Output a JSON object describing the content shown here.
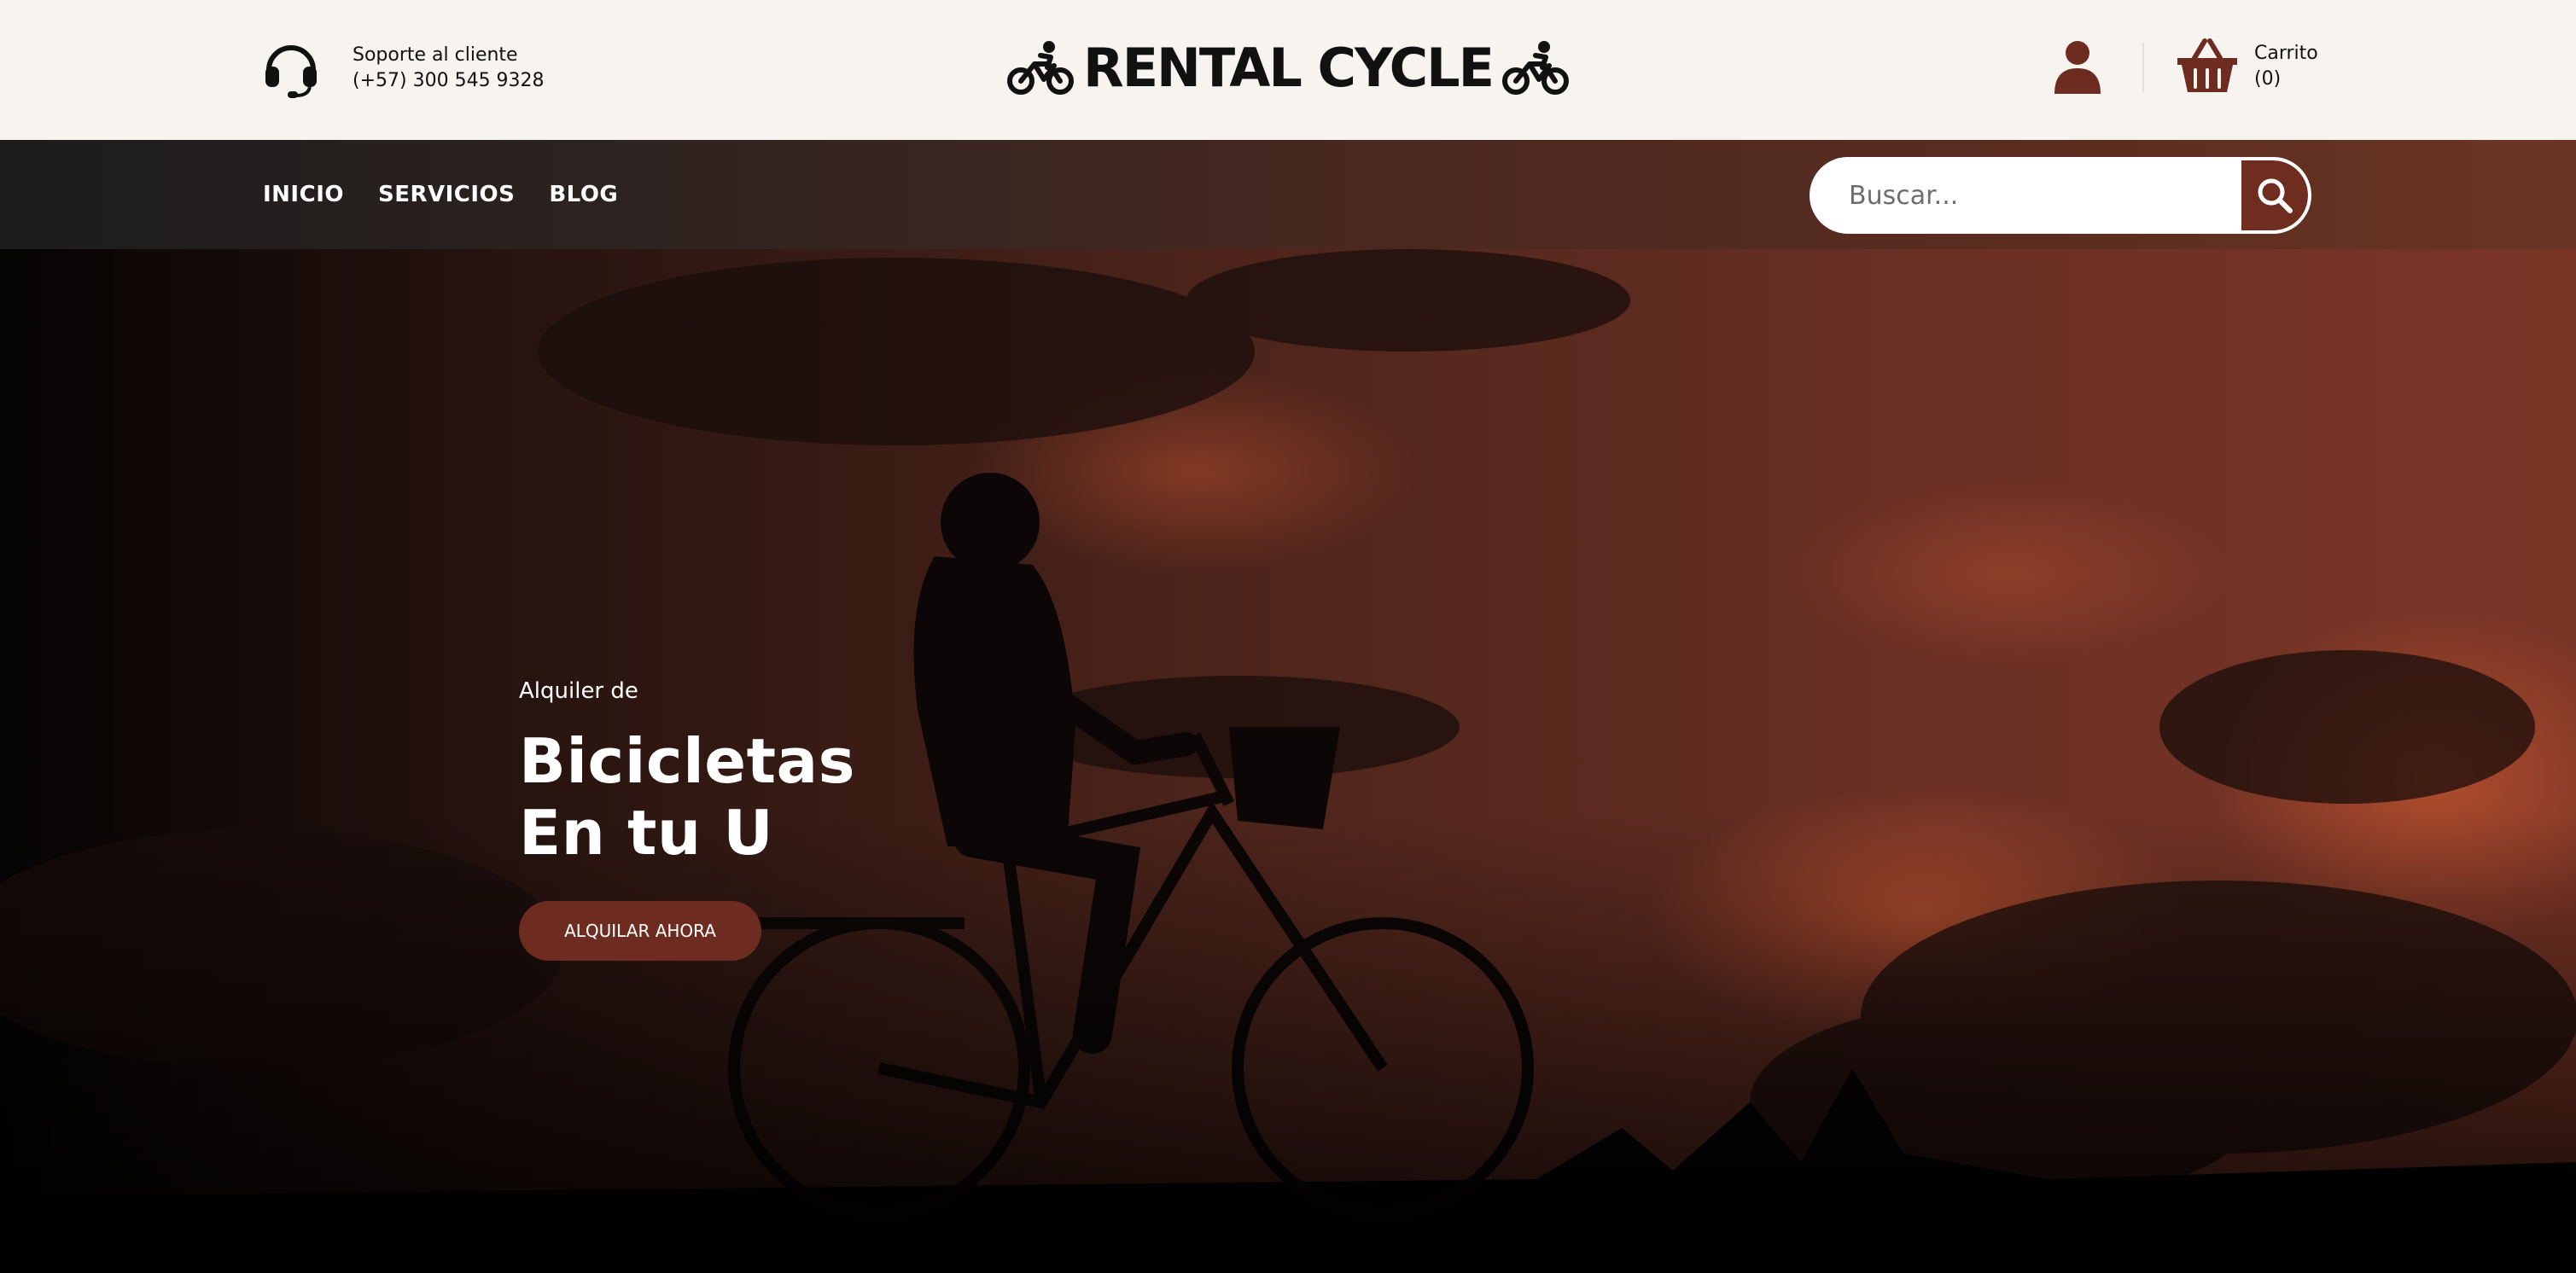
{
  "topbar": {
    "support_label": "Soporte al cliente",
    "support_phone": "(+57) 300 545 9328",
    "brand_name": "RENTAL CYCLE",
    "cart_label": "Carrito",
    "cart_count": "(0)"
  },
  "nav": {
    "links": [
      "INICIO",
      "SERVICIOS",
      "BLOG"
    ]
  },
  "search": {
    "placeholder": "Buscar..."
  },
  "hero": {
    "kicker": "Alquiler de",
    "title_line1": "Bicicletas",
    "title_line2": "En tu U",
    "cta_label": "ALQUILAR AHORA"
  },
  "icons": {
    "support": "headset-icon",
    "brand_left": "bicycle-rider-icon",
    "brand_right": "bicycle-rider-icon",
    "user": "user-icon",
    "cart": "basket-icon",
    "search": "search-icon"
  },
  "colors": {
    "accent": "#6e2c20",
    "topbar_bg": "#f7f4ef",
    "nav_gradient_start": "#1c1c1c",
    "nav_gradient_end": "#6b3524",
    "text_dark": "#111111"
  }
}
